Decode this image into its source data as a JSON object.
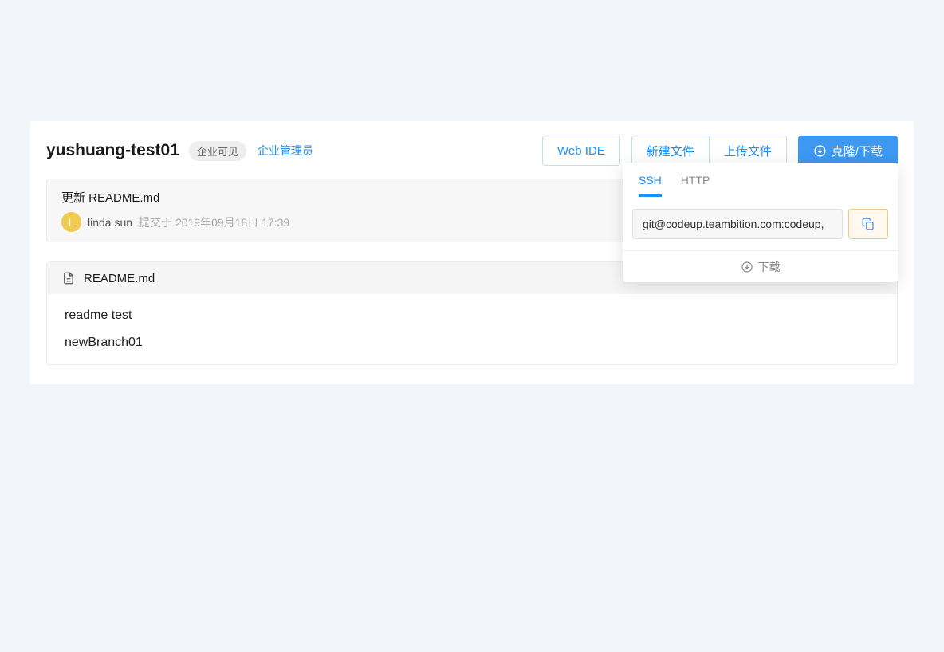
{
  "header": {
    "title": "yushuang-test01",
    "visibility_badge": "企业可见",
    "admin_link": "企业管理员",
    "web_ide_label": "Web IDE",
    "new_file_label": "新建文件",
    "upload_file_label": "上传文件",
    "clone_label": "克隆/下载"
  },
  "commit": {
    "message": "更新 README.md",
    "author_initial": "L",
    "author_name": "linda sun",
    "submitted_prefix": "提交于",
    "timestamp": "2019年09月18日 17:39"
  },
  "file": {
    "name": "README.md",
    "lines": [
      "readme test",
      "newBranch01"
    ]
  },
  "clone_dropdown": {
    "tabs": {
      "ssh": "SSH",
      "http": "HTTP"
    },
    "active_tab": "ssh",
    "url": "git@codeup.teambition.com:codeup,",
    "download_label": "下载"
  }
}
